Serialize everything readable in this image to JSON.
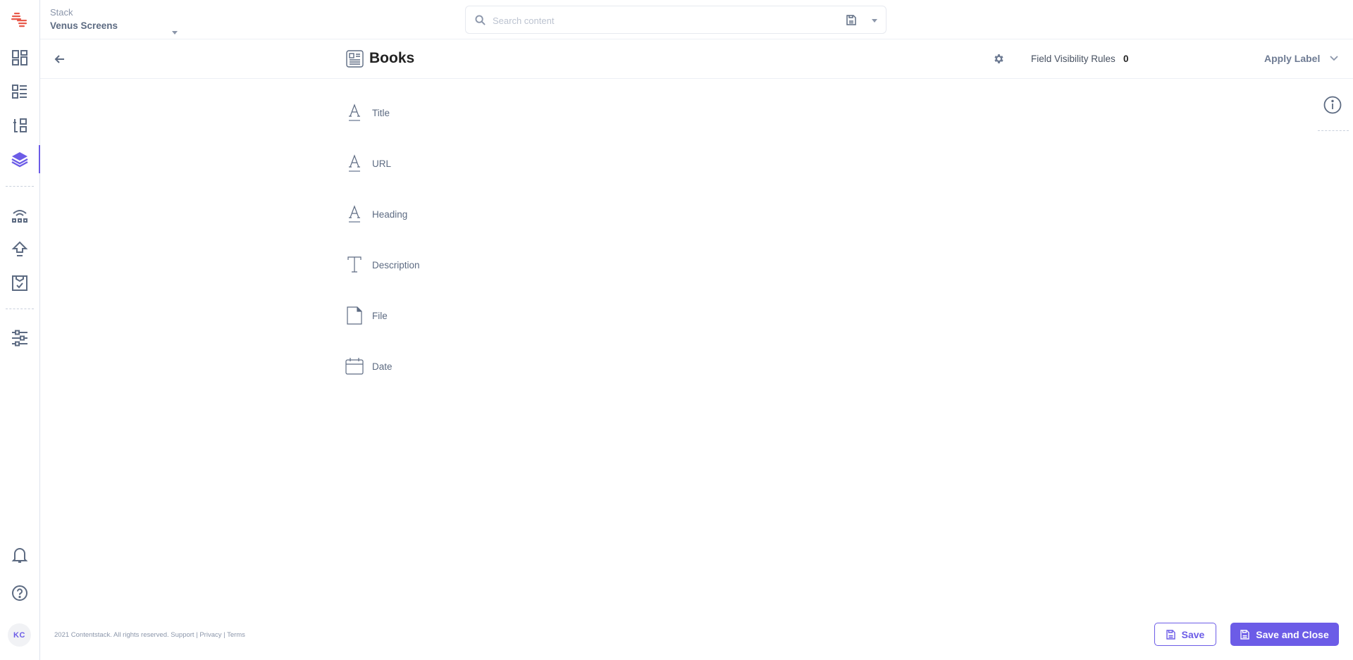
{
  "brand": {
    "accent": "#6c5ce7",
    "logo_color": "#e8594a"
  },
  "topbar": {
    "stack_label": "Stack",
    "stack_name": "Venus Screens",
    "search_placeholder": "Search content",
    "search_value": ""
  },
  "sidebar": {
    "items": [
      {
        "icon": "dashboard-icon",
        "label": "Dashboard"
      },
      {
        "icon": "entries-icon",
        "label": "Entries"
      },
      {
        "icon": "assets-icon",
        "label": "Assets"
      },
      {
        "icon": "content-models-icon",
        "label": "Content Models",
        "active": true
      },
      {
        "icon": "releases-icon",
        "label": "Releases"
      },
      {
        "icon": "publish-queue-icon",
        "label": "Publish Queue"
      },
      {
        "icon": "tasks-icon",
        "label": "Tasks"
      },
      {
        "icon": "settings-icon",
        "label": "Settings"
      }
    ],
    "bottom": {
      "notifications": "bell-icon",
      "help": "help-icon",
      "avatar_initials": "KC"
    }
  },
  "header": {
    "title": "Books",
    "field_visibility_label": "Field Visibility Rules",
    "field_visibility_count": "0",
    "apply_label": "Apply Label"
  },
  "fields": [
    {
      "icon": "single-line-text-icon",
      "label": "Title"
    },
    {
      "icon": "single-line-text-icon",
      "label": "URL"
    },
    {
      "icon": "single-line-text-icon",
      "label": "Heading"
    },
    {
      "icon": "multi-line-text-icon",
      "label": "Description"
    },
    {
      "icon": "file-icon",
      "label": "File"
    },
    {
      "icon": "date-icon",
      "label": "Date"
    }
  ],
  "footer": {
    "copyright": "2021 Contentstack. All rights reserved.",
    "support": "Support",
    "privacy": "Privacy",
    "terms": "Terms",
    "sep": "|"
  },
  "actions": {
    "save": "Save",
    "save_and_close": "Save and Close"
  }
}
